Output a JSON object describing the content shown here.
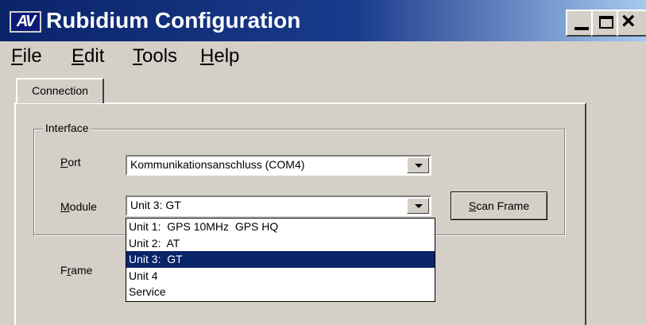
{
  "window": {
    "title": "Rubidium Configuration",
    "icon_text": "AV"
  },
  "menu": {
    "file": {
      "first": "F",
      "rest": "ile"
    },
    "edit": {
      "first": "E",
      "rest": "dit"
    },
    "tools": {
      "first": "T",
      "rest": "ools"
    },
    "help": {
      "first": "H",
      "rest": "elp"
    }
  },
  "tabs": {
    "connection": "Connection"
  },
  "interface_group": {
    "title": "Interface"
  },
  "port": {
    "label_first": "P",
    "label_rest": "ort",
    "value": "Kommunikationsanschluss (COM4)"
  },
  "module": {
    "label_first": "M",
    "label_rest": "odule",
    "value": "Unit 3:  GT",
    "options": [
      "Unit 1:  GPS 10MHz  GPS HQ",
      "Unit 2:  AT",
      "Unit 3:  GT",
      "Unit 4",
      "Service"
    ],
    "selected_index": 2
  },
  "scan_button": {
    "first": "S",
    "rest": "can Frame"
  },
  "frame": {
    "label_pre": "F",
    "label_u": "r",
    "label_post": "ame"
  },
  "icons": {
    "dropdown_arrow": "chevron-down-icon",
    "minimize": "minimize-icon",
    "maximize": "maximize-icon",
    "close": "close-icon"
  },
  "colors": {
    "titlebar": "#0a246a",
    "selection": "#0a246a",
    "face": "#d4d0c8"
  }
}
